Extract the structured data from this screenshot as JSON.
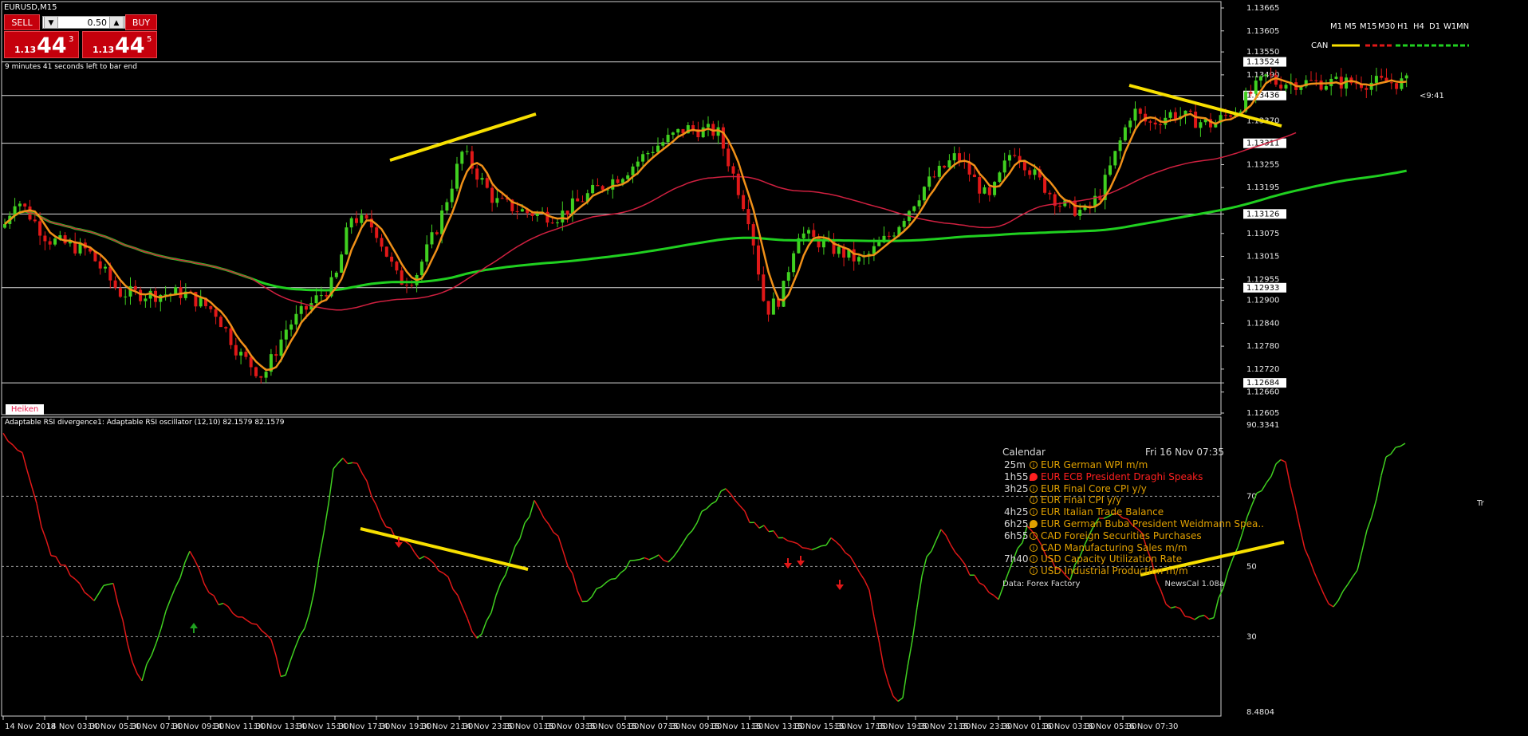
{
  "window": {
    "title": "EURUSD,M15",
    "timeframes": [
      "M1",
      "M5",
      "M15",
      "M30",
      "H1",
      "H4",
      "D1",
      "W1",
      "MN"
    ],
    "can_label": "CAN"
  },
  "trade_panel": {
    "sell_label": "SELL",
    "buy_label": "BUY",
    "lot": "0.50",
    "sell_price": {
      "prefix": "1.13",
      "big": "44",
      "sup": "3"
    },
    "buy_price": {
      "prefix": "1.13",
      "big": "44",
      "sup": "5"
    },
    "bar_timer": "9 minutes 41 seconds left to bar end"
  },
  "countdown_label": "<9:41",
  "heiken_label": "Heiken",
  "tr_label": "Tr",
  "price_axis": {
    "ticks": [
      "1.13665",
      "1.13605",
      "1.13550",
      "1.13490",
      "1.13436",
      "1.13370",
      "1.13311",
      "1.13255",
      "1.13195",
      "1.13126",
      "1.13075",
      "1.13015",
      "1.12955",
      "1.12933",
      "1.12900",
      "1.12840",
      "1.12780",
      "1.12720",
      "1.12684",
      "1.12660",
      "1.12605"
    ],
    "highlighted": [
      "1.13524",
      "1.13436",
      "1.13311",
      "1.13126",
      "1.12933",
      "1.12684"
    ]
  },
  "indicator": {
    "title": "Adaptable RSI divergence1: Adaptable RSI oscillator (12,10) 82.1579 82.1579",
    "axis_labels": [
      "90.3341",
      "70",
      "50",
      "30",
      "8.4804"
    ]
  },
  "time_axis": {
    "labels": [
      "14 Nov 2018",
      "14 Nov 03:30",
      "14 Nov 05:30",
      "14 Nov 07:30",
      "14 Nov 09:30",
      "14 Nov 11:30",
      "14 Nov 13:30",
      "14 Nov 15:30",
      "14 Nov 17:30",
      "14 Nov 19:30",
      "14 Nov 21:30",
      "14 Nov 23:30",
      "15 Nov 01:30",
      "15 Nov 03:30",
      "15 Nov 05:30",
      "15 Nov 07:30",
      "15 Nov 09:30",
      "15 Nov 11:30",
      "15 Nov 13:30",
      "15 Nov 15:30",
      "15 Nov 17:30",
      "15 Nov 19:30",
      "15 Nov 21:30",
      "15 Nov 23:30",
      "16 Nov 01:30",
      "16 Nov 03:30",
      "16 Nov 05:30",
      "16 Nov 07:30"
    ]
  },
  "calendar": {
    "header": "Calendar",
    "date": "Fri 16 Nov 07:35",
    "events": [
      {
        "time": "25m",
        "text": "EUR German WPI m/m",
        "color": "#e0a000",
        "icon": "info-icon"
      },
      {
        "time": "1h55",
        "text": "EUR ECB President Draghi Speaks",
        "color": "#ff2020",
        "icon": "speech-icon"
      },
      {
        "time": "3h25",
        "text": "EUR Final Core CPI y/y",
        "color": "#e0a000",
        "icon": "info-icon"
      },
      {
        "time": "",
        "text": "EUR Final CPI y/y",
        "color": "#e0a000",
        "icon": "info-icon"
      },
      {
        "time": "4h25",
        "text": "EUR Italian Trade Balance",
        "color": "#e0a000",
        "icon": "info-icon"
      },
      {
        "time": "6h25",
        "text": "EUR German Buba President Weidmann Spea..",
        "color": "#e0a000",
        "icon": "speech-icon"
      },
      {
        "time": "6h55",
        "text": "CAD Foreign Securities Purchases",
        "color": "#e0a000",
        "icon": "info-icon"
      },
      {
        "time": "",
        "text": "CAD Manufacturing Sales m/m",
        "color": "#e0a000",
        "icon": "info-icon"
      },
      {
        "time": "7h40",
        "text": "USD Capacity Utilization Rate",
        "color": "#e0a000",
        "icon": "info-icon"
      },
      {
        "time": "",
        "text": "USD Industrial Production m/m",
        "color": "#e0a000",
        "icon": "info-icon"
      }
    ],
    "source": "Data: Forex Factory",
    "version": "NewsCal 1.08a"
  },
  "colors": {
    "bull": "#40d020",
    "bear": "#e01818",
    "orange_ma": "#f09018",
    "red_ma": "#d02040",
    "green_ma": "#20d020",
    "yellow_trend": "#f8e000",
    "grid": "#7a7a7a"
  }
}
